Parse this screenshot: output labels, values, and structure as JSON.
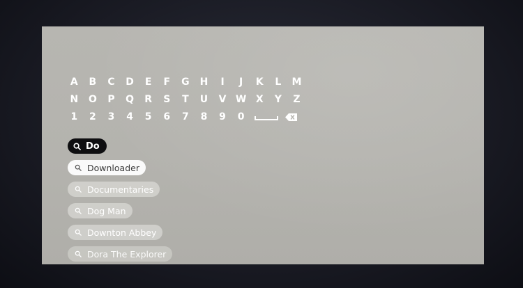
{
  "keyboard": {
    "rows": [
      [
        "A",
        "B",
        "C",
        "D",
        "E",
        "F",
        "G",
        "H",
        "I",
        "J",
        "K",
        "L",
        "M"
      ],
      [
        "N",
        "O",
        "P",
        "Q",
        "R",
        "S",
        "T",
        "U",
        "V",
        "W",
        "X",
        "Y",
        "Z"
      ],
      [
        "1",
        "2",
        "3",
        "4",
        "5",
        "6",
        "7",
        "8",
        "9",
        "0"
      ]
    ],
    "space_icon": "space-icon",
    "backspace_icon": "backspace-icon"
  },
  "search": {
    "query": "Do",
    "icon": "search-icon"
  },
  "suggestions": [
    {
      "label": "Downloader",
      "state": "active"
    },
    {
      "label": "Documentaries",
      "state": "dim"
    },
    {
      "label": "Dog Man",
      "state": "dim"
    },
    {
      "label": "Downton Abbey",
      "state": "dim"
    },
    {
      "label": "Dora The Explorer",
      "state": "fade"
    }
  ],
  "colors": {
    "screen": "#b5b4af",
    "query_pill": "#0e0e10",
    "active_suggestion": "#fafafa"
  }
}
